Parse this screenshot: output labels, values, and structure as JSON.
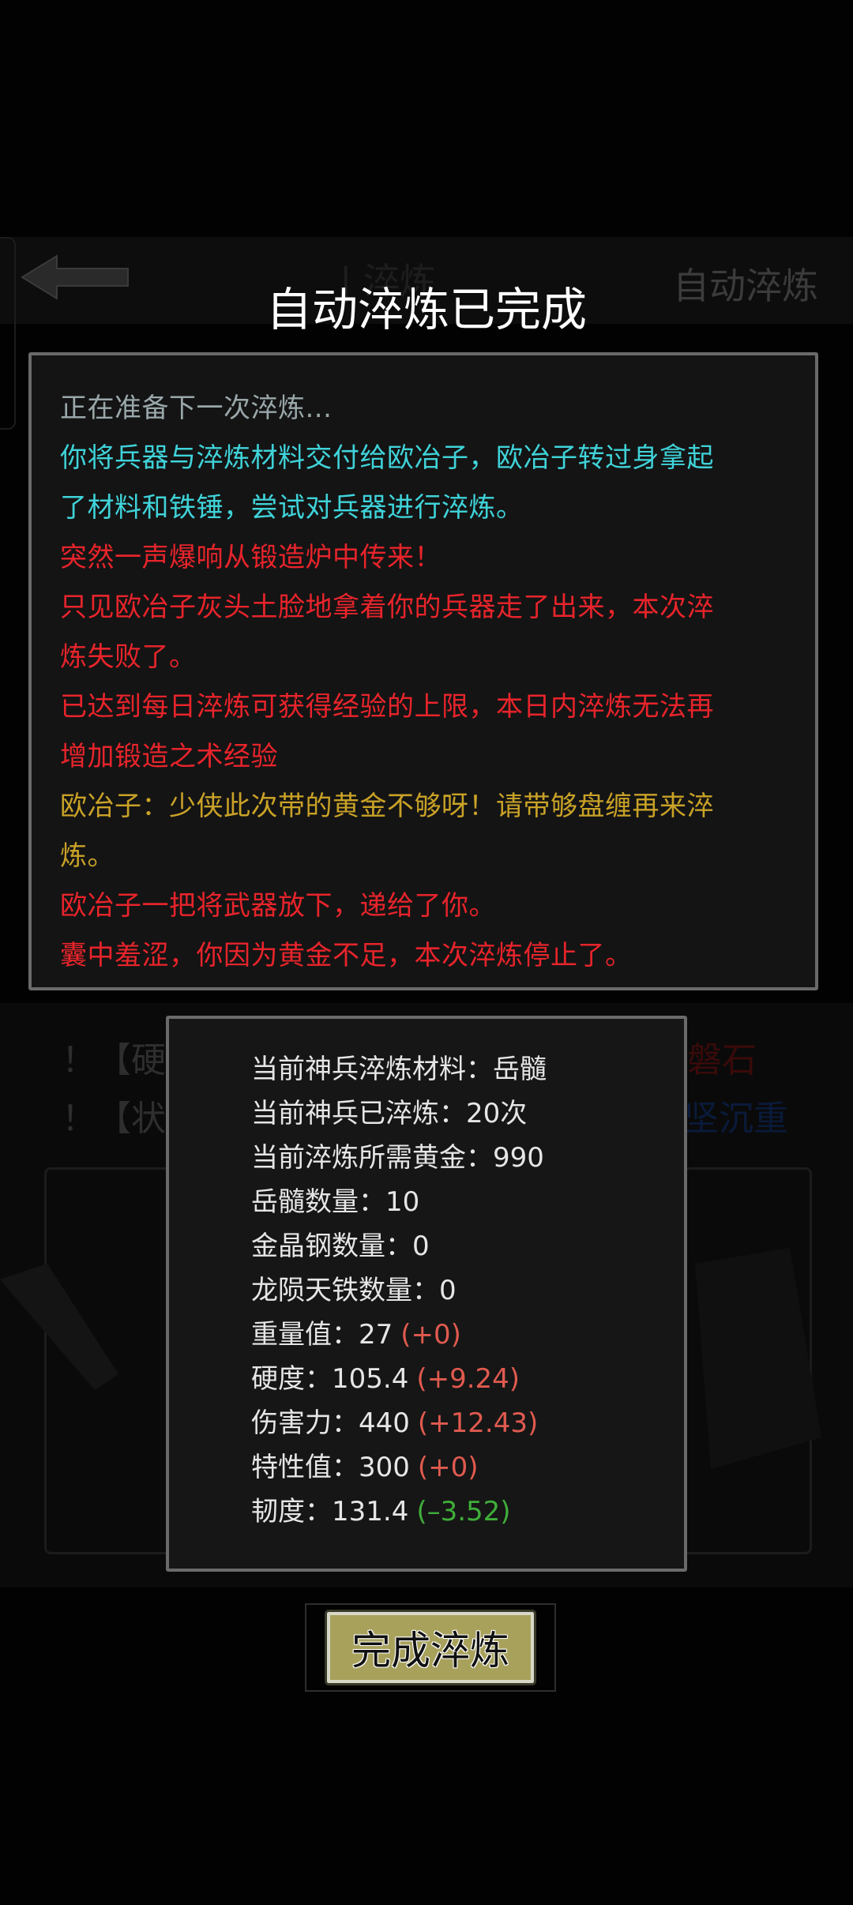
{
  "background": {
    "title": "| 淬炼",
    "auto_label": "自动淬炼",
    "warnings": [
      {
        "left": "！【硬度",
        "right": "坚磐石"
      },
      {
        "left": "！【状态",
        "right": "坚沉重"
      }
    ]
  },
  "dialog": {
    "title": "自动淬炼已完成",
    "log": [
      {
        "text": "正在准备下一次淬炼...",
        "color": "#9aa7aa"
      },
      {
        "text": "你将兵器与淬炼材料交付给欧冶子，欧冶子转过身拿起",
        "color": "#3fd3d9"
      },
      {
        "text": "了材料和铁锤，尝试对兵器进行淬炼。",
        "color": "#3fd3d9"
      },
      {
        "text": "突然一声爆响从锻造炉中传来！",
        "color": "#e8242b"
      },
      {
        "text": "只见欧冶子灰头土脸地拿着你的兵器走了出来，本次淬",
        "color": "#e8242b"
      },
      {
        "text": "炼失败了。",
        "color": "#e8242b"
      },
      {
        "text": "已达到每日淬炼可获得经验的上限，本日内淬炼无法再",
        "color": "#e8242b"
      },
      {
        "text": "增加锻造之术经验",
        "color": "#e8242b"
      },
      {
        "text": "欧冶子：少侠此次带的黄金不够呀！请带够盘缠再来淬",
        "color": "#c9a227"
      },
      {
        "text": "炼。",
        "color": "#c9a227"
      },
      {
        "text": "欧冶子一把将武器放下，递给了你。",
        "color": "#e8242b"
      },
      {
        "text": "囊中羞涩，你因为黄金不足，本次淬炼停止了。",
        "color": "#e8242b"
      }
    ],
    "stats": [
      {
        "label": "当前神兵淬炼材料：",
        "value": "岳髓",
        "delta": ""
      },
      {
        "label": "当前神兵已淬炼：",
        "value": "20次",
        "delta": ""
      },
      {
        "label": "当前淬炼所需黄金：",
        "value": "990",
        "delta": ""
      },
      {
        "label": "岳髓数量：",
        "value": "10",
        "delta": ""
      },
      {
        "label": "金晶钢数量：",
        "value": "0",
        "delta": ""
      },
      {
        "label": "龙陨天铁数量：",
        "value": "0",
        "delta": ""
      },
      {
        "label": "重量值：",
        "value": "27",
        "delta": "(+0)",
        "delta_color": "#e05a4f"
      },
      {
        "label": "硬度：",
        "value": "105.4",
        "delta": "(+9.24)",
        "delta_color": "#e05a4f"
      },
      {
        "label": "伤害力：",
        "value": "440",
        "delta": "(+12.43)",
        "delta_color": "#e05a4f"
      },
      {
        "label": "特性值：",
        "value": "300",
        "delta": "(+0)",
        "delta_color": "#e05a4f"
      },
      {
        "label": "韧度：",
        "value": "131.4",
        "delta": "(–3.52)",
        "delta_color": "#3fae3a"
      }
    ],
    "finish_label": "完成淬炼"
  }
}
